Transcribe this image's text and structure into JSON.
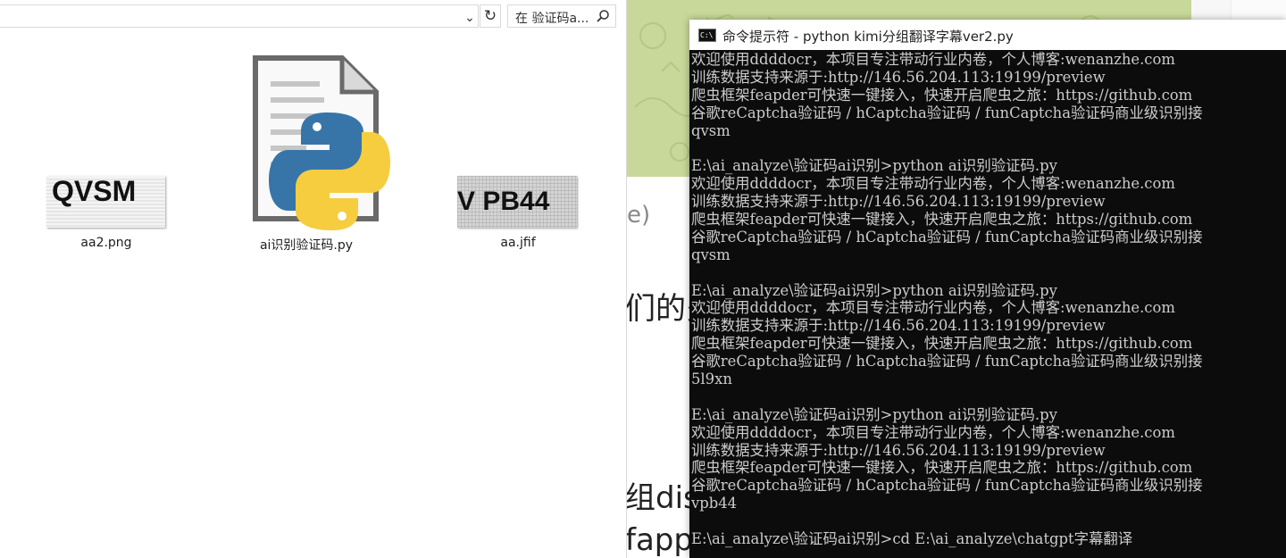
{
  "explorer": {
    "search_placeholder": "在 验证码a...",
    "files": [
      {
        "name": "aa2.png",
        "thumb_text": "QVSM"
      },
      {
        "name": "ai识别验证码.py"
      },
      {
        "name": "aa.jfif",
        "thumb_text": "V PB44"
      }
    ]
  },
  "background": {
    "fragments": [
      "e)",
      "们的多",
      "组disc",
      "fapp"
    ]
  },
  "console": {
    "title": "命令提示符 - python  kimi分组翻译字幕ver2.py",
    "lines": [
      "欢迎使用ddddocr，本项目专注带动行业内卷，个人博客:wenanzhe.com",
      "训练数据支持来源于:http://146.56.204.113:19199/preview",
      "爬虫框架feapder可快速一键接入，快速开启爬虫之旅：https://github.com",
      "谷歌reCaptcha验证码 / hCaptcha验证码 / funCaptcha验证码商业级识别接",
      "qvsm",
      "",
      "E:\\ai_analyze\\验证码ai识别>python ai识别验证码.py",
      "欢迎使用ddddocr，本项目专注带动行业内卷，个人博客:wenanzhe.com",
      "训练数据支持来源于:http://146.56.204.113:19199/preview",
      "爬虫框架feapder可快速一键接入，快速开启爬虫之旅：https://github.com",
      "谷歌reCaptcha验证码 / hCaptcha验证码 / funCaptcha验证码商业级识别接",
      "qvsm",
      "",
      "E:\\ai_analyze\\验证码ai识别>python ai识别验证码.py",
      "欢迎使用ddddocr，本项目专注带动行业内卷，个人博客:wenanzhe.com",
      "训练数据支持来源于:http://146.56.204.113:19199/preview",
      "爬虫框架feapder可快速一键接入，快速开启爬虫之旅：https://github.com",
      "谷歌reCaptcha验证码 / hCaptcha验证码 / funCaptcha验证码商业级识别接",
      "5l9xn",
      "",
      "E:\\ai_analyze\\验证码ai识别>python ai识别验证码.py",
      "欢迎使用ddddocr，本项目专注带动行业内卷，个人博客:wenanzhe.com",
      "训练数据支持来源于:http://146.56.204.113:19199/preview",
      "爬虫框架feapder可快速一键接入，快速开启爬虫之旅：https://github.com",
      "谷歌reCaptcha验证码 / hCaptcha验证码 / funCaptcha验证码商业级识别接",
      "vpb44",
      "",
      "E:\\ai_analyze\\验证码ai识别>cd E:\\ai_analyze\\chatgpt字幕翻译"
    ]
  }
}
